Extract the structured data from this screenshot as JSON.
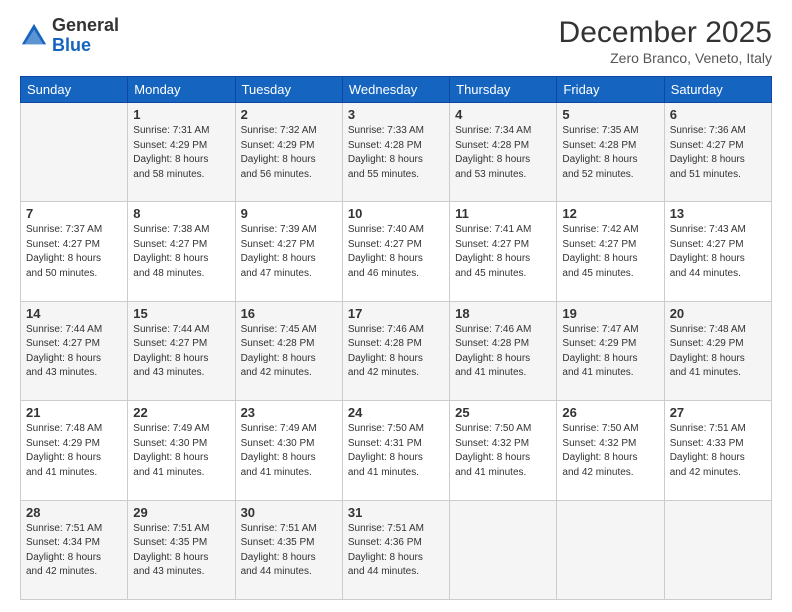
{
  "header": {
    "logo_general": "General",
    "logo_blue": "Blue",
    "month_title": "December 2025",
    "location": "Zero Branco, Veneto, Italy"
  },
  "days_of_week": [
    "Sunday",
    "Monday",
    "Tuesday",
    "Wednesday",
    "Thursday",
    "Friday",
    "Saturday"
  ],
  "weeks": [
    [
      {
        "day": "",
        "info": ""
      },
      {
        "day": "1",
        "info": "Sunrise: 7:31 AM\nSunset: 4:29 PM\nDaylight: 8 hours\nand 58 minutes."
      },
      {
        "day": "2",
        "info": "Sunrise: 7:32 AM\nSunset: 4:29 PM\nDaylight: 8 hours\nand 56 minutes."
      },
      {
        "day": "3",
        "info": "Sunrise: 7:33 AM\nSunset: 4:28 PM\nDaylight: 8 hours\nand 55 minutes."
      },
      {
        "day": "4",
        "info": "Sunrise: 7:34 AM\nSunset: 4:28 PM\nDaylight: 8 hours\nand 53 minutes."
      },
      {
        "day": "5",
        "info": "Sunrise: 7:35 AM\nSunset: 4:28 PM\nDaylight: 8 hours\nand 52 minutes."
      },
      {
        "day": "6",
        "info": "Sunrise: 7:36 AM\nSunset: 4:27 PM\nDaylight: 8 hours\nand 51 minutes."
      }
    ],
    [
      {
        "day": "7",
        "info": "Sunrise: 7:37 AM\nSunset: 4:27 PM\nDaylight: 8 hours\nand 50 minutes."
      },
      {
        "day": "8",
        "info": "Sunrise: 7:38 AM\nSunset: 4:27 PM\nDaylight: 8 hours\nand 48 minutes."
      },
      {
        "day": "9",
        "info": "Sunrise: 7:39 AM\nSunset: 4:27 PM\nDaylight: 8 hours\nand 47 minutes."
      },
      {
        "day": "10",
        "info": "Sunrise: 7:40 AM\nSunset: 4:27 PM\nDaylight: 8 hours\nand 46 minutes."
      },
      {
        "day": "11",
        "info": "Sunrise: 7:41 AM\nSunset: 4:27 PM\nDaylight: 8 hours\nand 45 minutes."
      },
      {
        "day": "12",
        "info": "Sunrise: 7:42 AM\nSunset: 4:27 PM\nDaylight: 8 hours\nand 45 minutes."
      },
      {
        "day": "13",
        "info": "Sunrise: 7:43 AM\nSunset: 4:27 PM\nDaylight: 8 hours\nand 44 minutes."
      }
    ],
    [
      {
        "day": "14",
        "info": "Sunrise: 7:44 AM\nSunset: 4:27 PM\nDaylight: 8 hours\nand 43 minutes."
      },
      {
        "day": "15",
        "info": "Sunrise: 7:44 AM\nSunset: 4:27 PM\nDaylight: 8 hours\nand 43 minutes."
      },
      {
        "day": "16",
        "info": "Sunrise: 7:45 AM\nSunset: 4:28 PM\nDaylight: 8 hours\nand 42 minutes."
      },
      {
        "day": "17",
        "info": "Sunrise: 7:46 AM\nSunset: 4:28 PM\nDaylight: 8 hours\nand 42 minutes."
      },
      {
        "day": "18",
        "info": "Sunrise: 7:46 AM\nSunset: 4:28 PM\nDaylight: 8 hours\nand 41 minutes."
      },
      {
        "day": "19",
        "info": "Sunrise: 7:47 AM\nSunset: 4:29 PM\nDaylight: 8 hours\nand 41 minutes."
      },
      {
        "day": "20",
        "info": "Sunrise: 7:48 AM\nSunset: 4:29 PM\nDaylight: 8 hours\nand 41 minutes."
      }
    ],
    [
      {
        "day": "21",
        "info": "Sunrise: 7:48 AM\nSunset: 4:29 PM\nDaylight: 8 hours\nand 41 minutes."
      },
      {
        "day": "22",
        "info": "Sunrise: 7:49 AM\nSunset: 4:30 PM\nDaylight: 8 hours\nand 41 minutes."
      },
      {
        "day": "23",
        "info": "Sunrise: 7:49 AM\nSunset: 4:30 PM\nDaylight: 8 hours\nand 41 minutes."
      },
      {
        "day": "24",
        "info": "Sunrise: 7:50 AM\nSunset: 4:31 PM\nDaylight: 8 hours\nand 41 minutes."
      },
      {
        "day": "25",
        "info": "Sunrise: 7:50 AM\nSunset: 4:32 PM\nDaylight: 8 hours\nand 41 minutes."
      },
      {
        "day": "26",
        "info": "Sunrise: 7:50 AM\nSunset: 4:32 PM\nDaylight: 8 hours\nand 42 minutes."
      },
      {
        "day": "27",
        "info": "Sunrise: 7:51 AM\nSunset: 4:33 PM\nDaylight: 8 hours\nand 42 minutes."
      }
    ],
    [
      {
        "day": "28",
        "info": "Sunrise: 7:51 AM\nSunset: 4:34 PM\nDaylight: 8 hours\nand 42 minutes."
      },
      {
        "day": "29",
        "info": "Sunrise: 7:51 AM\nSunset: 4:35 PM\nDaylight: 8 hours\nand 43 minutes."
      },
      {
        "day": "30",
        "info": "Sunrise: 7:51 AM\nSunset: 4:35 PM\nDaylight: 8 hours\nand 44 minutes."
      },
      {
        "day": "31",
        "info": "Sunrise: 7:51 AM\nSunset: 4:36 PM\nDaylight: 8 hours\nand 44 minutes."
      },
      {
        "day": "",
        "info": ""
      },
      {
        "day": "",
        "info": ""
      },
      {
        "day": "",
        "info": ""
      }
    ]
  ]
}
